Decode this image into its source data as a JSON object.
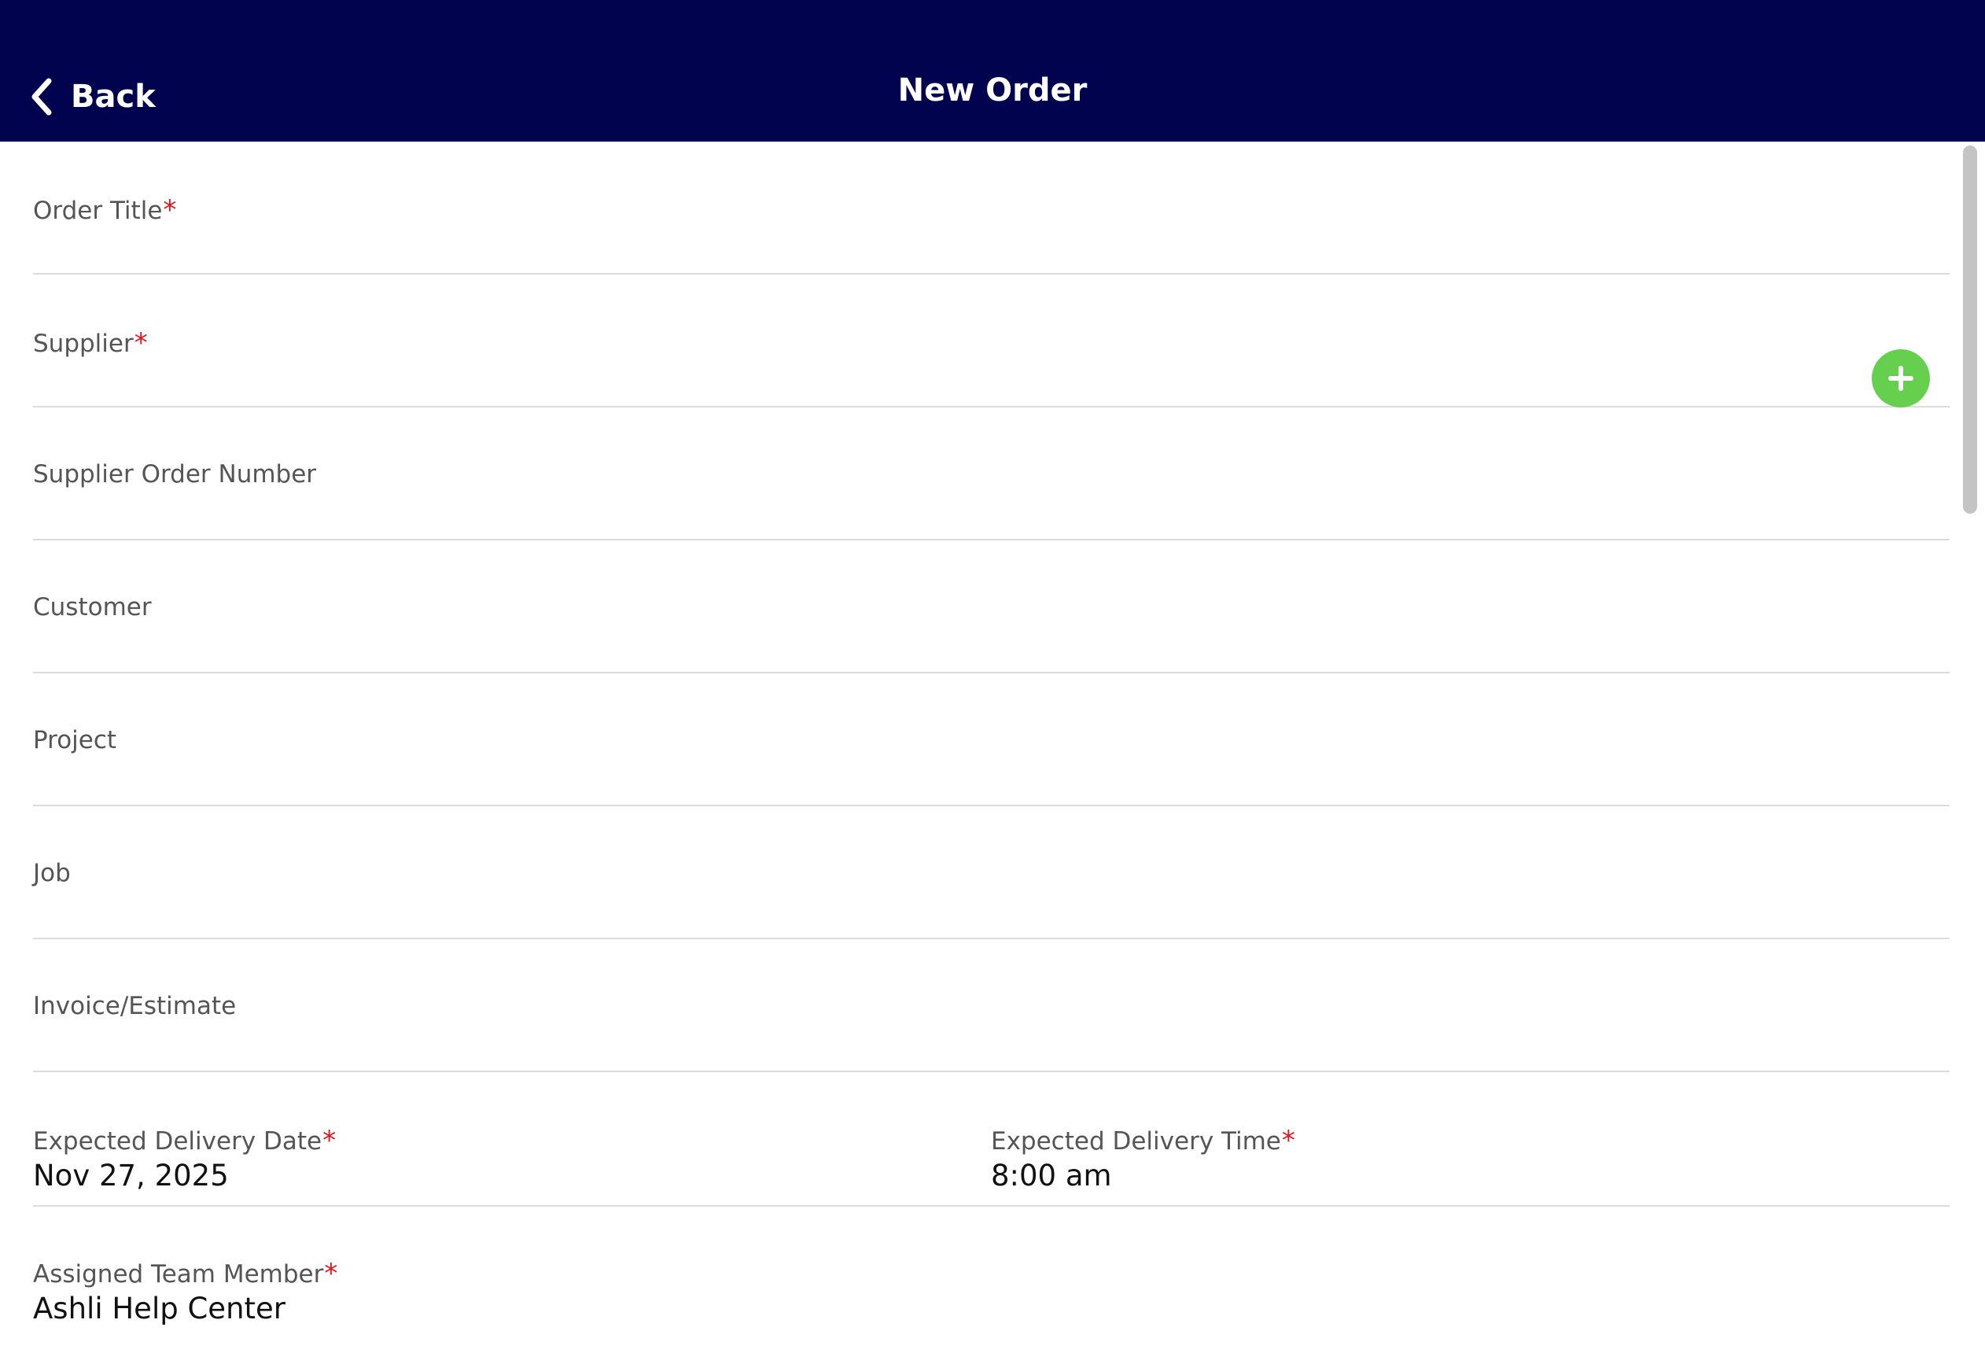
{
  "header": {
    "back_label": "Back",
    "title": "New Order",
    "background_color": "#01034e"
  },
  "form": {
    "order_title": {
      "label": "Order Title",
      "required": "*",
      "value": ""
    },
    "supplier": {
      "label": "Supplier",
      "required": "*",
      "value": ""
    },
    "supplier_order_number": {
      "label": "Supplier Order Number",
      "value": ""
    },
    "customer": {
      "label": "Customer",
      "value": ""
    },
    "project": {
      "label": "Project",
      "value": ""
    },
    "job": {
      "label": "Job",
      "value": ""
    },
    "invoice_estimate": {
      "label": "Invoice/Estimate",
      "value": ""
    },
    "expected_delivery_date": {
      "label": "Expected Delivery Date",
      "required": "*",
      "value": "Nov 27, 2025"
    },
    "expected_delivery_time": {
      "label": "Expected Delivery Time",
      "required": "*",
      "value": "8:00 am"
    },
    "assigned_team_member": {
      "label": "Assigned Team Member",
      "required": "*",
      "value": "Ashli Help Center"
    }
  },
  "icons": {
    "back": "chevron-left-icon",
    "add": "plus-icon"
  },
  "colors": {
    "accent_add": "#66d04e",
    "required": "#e0161e"
  }
}
